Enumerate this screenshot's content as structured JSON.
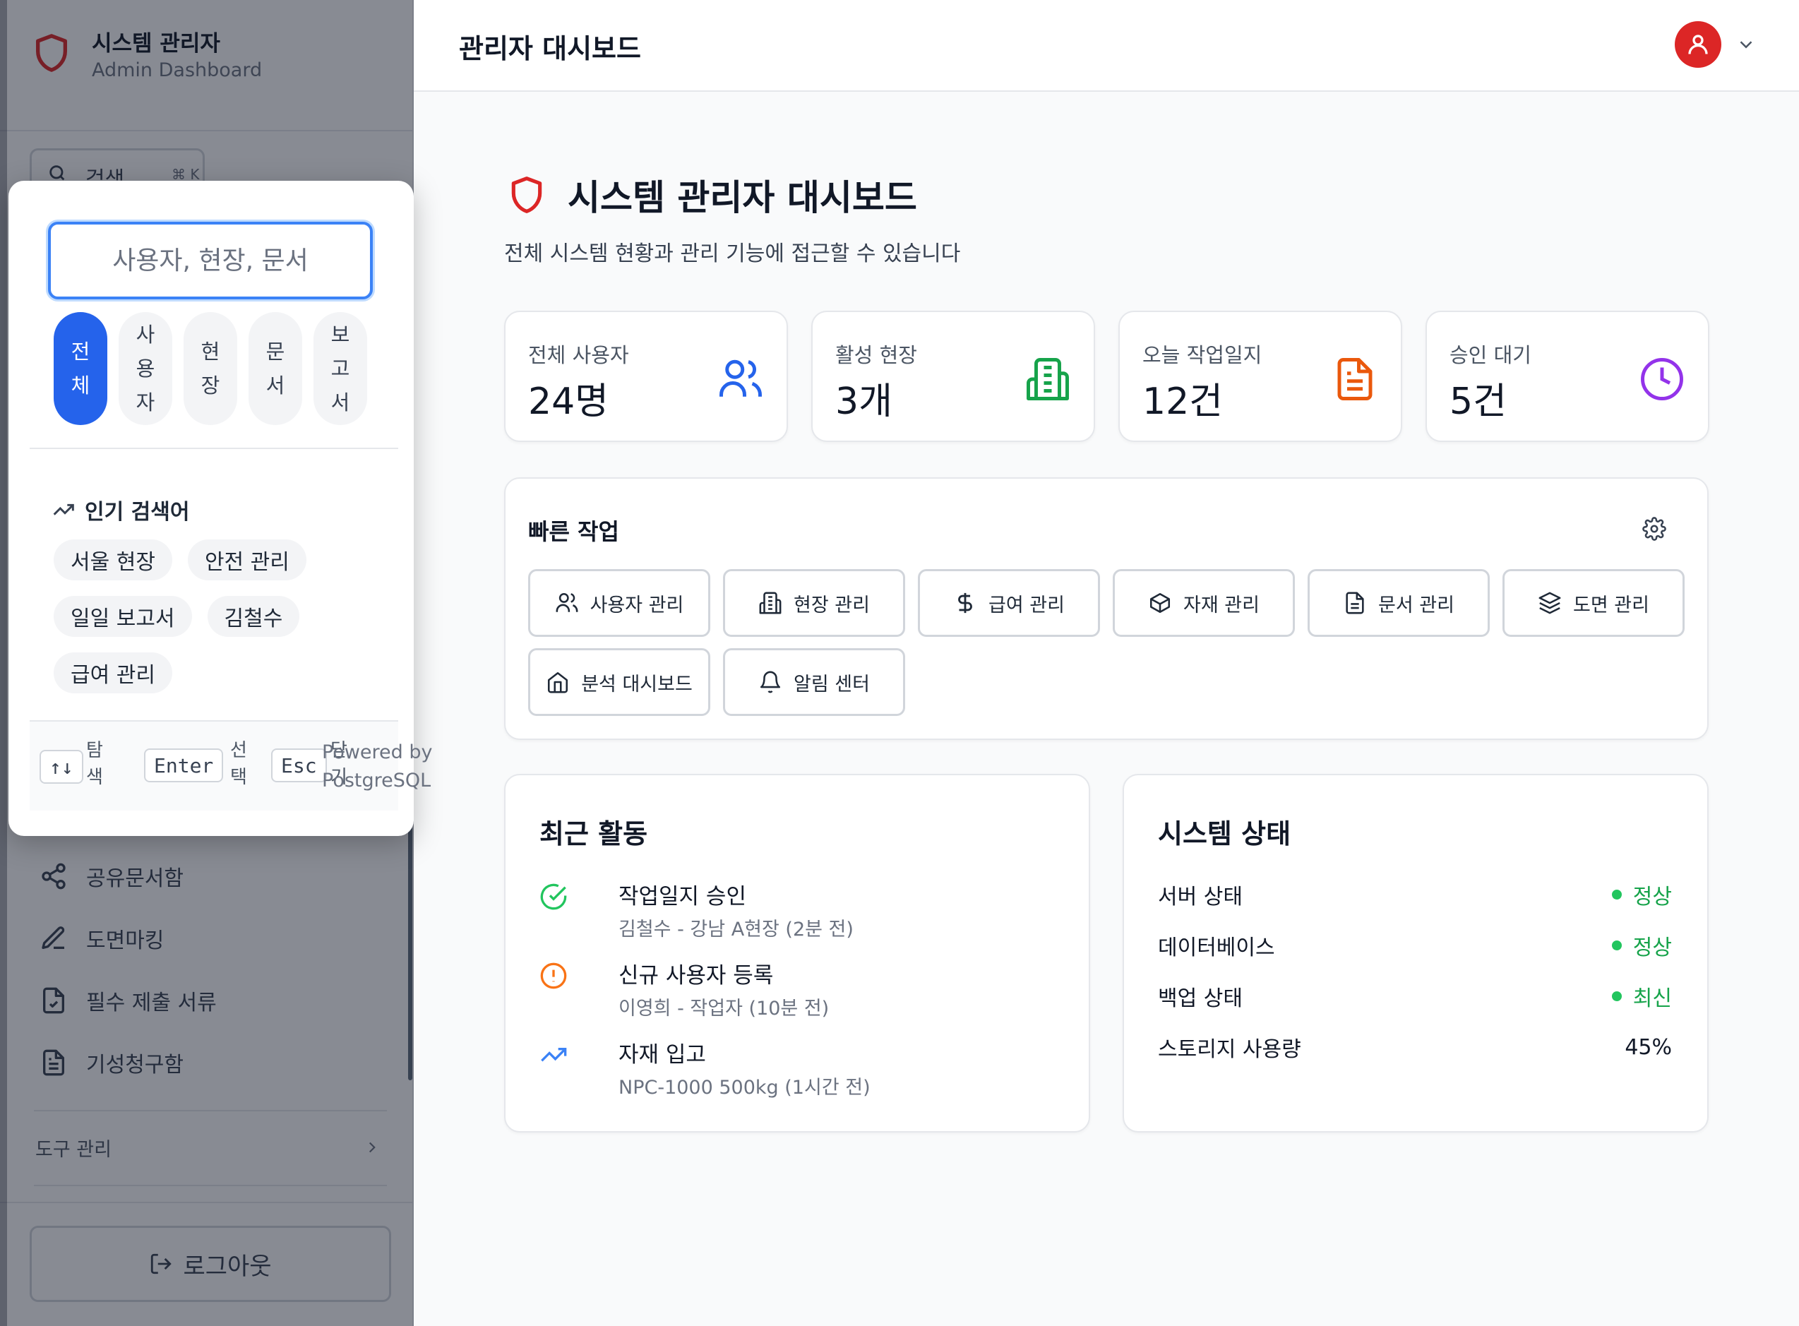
{
  "sidebar": {
    "brand_title": "시스템 관리자",
    "brand_subtitle": "Admin Dashboard",
    "search_label": "검색",
    "search_shortcut": "⌘ K",
    "nav_items": [
      {
        "label": "공유문서함",
        "icon": "share-icon"
      },
      {
        "label": "도면마킹",
        "icon": "pen-icon"
      },
      {
        "label": "필수 제출 서류",
        "icon": "file-check-icon"
      },
      {
        "label": "기성청구함",
        "icon": "file-text-icon"
      }
    ],
    "group_label": "도구 관리",
    "logout_label": "로그아웃"
  },
  "search_popover": {
    "input_placeholder": "사용자, 현장, 문서",
    "input_value": "",
    "categories": [
      "전체",
      "사용자",
      "현장",
      "문서",
      "보고서"
    ],
    "active_category": "전체",
    "popular_title": "인기 검색어",
    "popular_tags": [
      "서울 현장",
      "안전 관리",
      "일일 보고서",
      "김철수",
      "급여 관리"
    ],
    "shortcuts": [
      {
        "key": "↑↓",
        "label": "탐색"
      },
      {
        "key": "Enter",
        "label": "선택"
      },
      {
        "key": "Esc",
        "label": "닫기"
      }
    ],
    "powered_by": "Powered by PostgreSQL"
  },
  "header": {
    "title": "관리자 대시보드",
    "avatar_color": "#dc2626"
  },
  "main": {
    "title": "시스템 관리자 대시보드",
    "subtitle": "전체 시스템 현황과 관리 기능에 접근할 수 있습니다",
    "stats": [
      {
        "label": "전체 사용자",
        "value": "24명",
        "icon": "users-icon",
        "color": "#2563eb"
      },
      {
        "label": "활성 현장",
        "value": "3개",
        "icon": "building-icon",
        "color": "#16a34a"
      },
      {
        "label": "오늘 작업일지",
        "value": "12건",
        "icon": "document-icon",
        "color": "#ea580c"
      },
      {
        "label": "승인 대기",
        "value": "5건",
        "icon": "clock-icon",
        "color": "#9333ea"
      }
    ],
    "quick_actions": {
      "title": "빠른 작업",
      "buttons": [
        {
          "label": "사용자 관리",
          "icon": "users-icon"
        },
        {
          "label": "현장 관리",
          "icon": "building-icon"
        },
        {
          "label": "급여 관리",
          "icon": "dollar-icon"
        },
        {
          "label": "자재 관리",
          "icon": "package-icon"
        },
        {
          "label": "문서 관리",
          "icon": "file-icon"
        },
        {
          "label": "도면 관리",
          "icon": "layers-icon"
        },
        {
          "label": "분석 대시보드",
          "icon": "home-icon"
        },
        {
          "label": "알림 센터",
          "icon": "bell-icon"
        }
      ]
    },
    "recent_activity": {
      "title": "최근 활동",
      "items": [
        {
          "title": "작업일지 승인",
          "detail": "김철수 - 강남 A현장 (2분 전)",
          "icon": "check-circle-icon",
          "color": "#22c55e"
        },
        {
          "title": "신규 사용자 등록",
          "detail": "이영희 - 작업자 (10분 전)",
          "icon": "alert-circle-icon",
          "color": "#f97316"
        },
        {
          "title": "자재 입고",
          "detail": "NPC-1000 500kg (1시간 전)",
          "icon": "trending-up-icon",
          "color": "#3b82f6"
        }
      ]
    },
    "system_status": {
      "title": "시스템 상태",
      "rows": [
        {
          "key": "서버 상태",
          "value": "정상"
        },
        {
          "key": "데이터베이스",
          "value": "정상"
        },
        {
          "key": "백업 상태",
          "value": "최신"
        },
        {
          "key": "스토리지 사용량",
          "value": "45%"
        }
      ],
      "ok_color": "#16a34a"
    }
  }
}
